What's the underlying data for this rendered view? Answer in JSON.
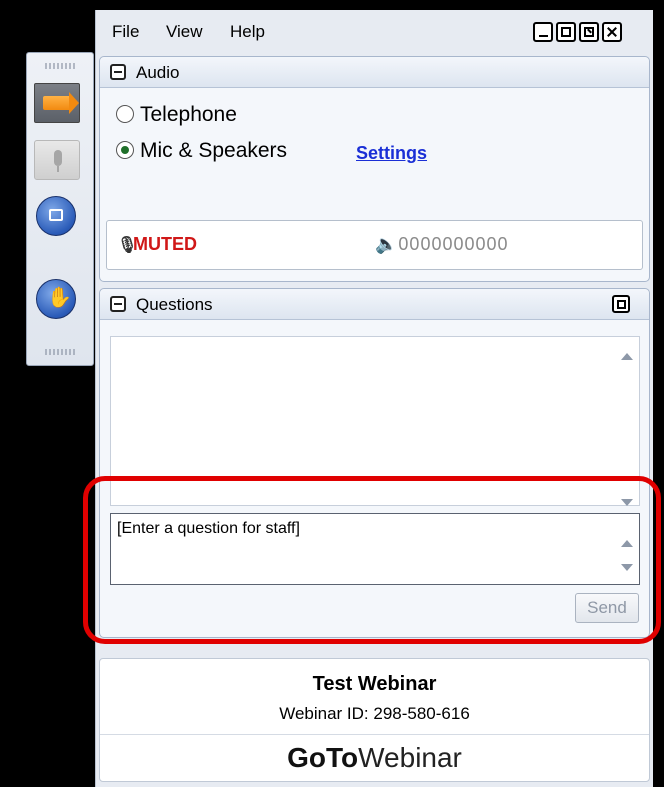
{
  "menu": {
    "file": "File",
    "view": "View",
    "help": "Help"
  },
  "audio": {
    "title": "Audio",
    "options": [
      {
        "label": "Telephone",
        "selected": false
      },
      {
        "label": "Mic & Speakers",
        "selected": true
      }
    ],
    "settings_link": "Settings",
    "status": "MUTED",
    "volume_level": "0000000000"
  },
  "questions": {
    "title": "Questions",
    "input_placeholder": "[Enter a question for staff]",
    "send_label": "Send"
  },
  "footer": {
    "webinar_title": "Test Webinar",
    "webinar_id": "Webinar ID: 298-580-616",
    "brand_bold": "GoTo",
    "brand_light": "Webinar"
  },
  "colors": {
    "muted": "#d01818",
    "link": "#1a2fd6",
    "highlight": "#e00000",
    "selected_radio": "#1f6f2a"
  }
}
